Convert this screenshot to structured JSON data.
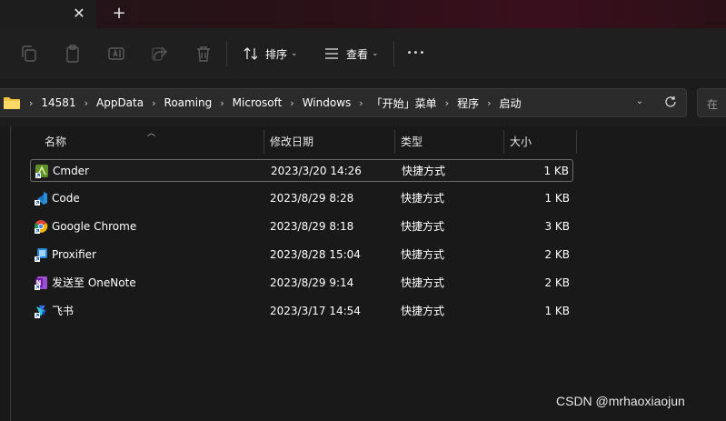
{
  "tabs": {
    "close_glyph": "✕",
    "new_glyph": "+"
  },
  "toolbar": {
    "sort_label": "排序",
    "view_label": "查看",
    "more_glyph": "•••",
    "chevron": "⌄"
  },
  "address": {
    "breadcrumbs": [
      "14581",
      "AppData",
      "Roaming",
      "Microsoft",
      "Windows",
      "「开始」菜单",
      "程序",
      "启动"
    ],
    "separator": "›",
    "search_placeholder": "在"
  },
  "columns": {
    "name": "名称",
    "modified": "修改日期",
    "type": "类型",
    "size": "大小"
  },
  "files": [
    {
      "name": "Cmder",
      "modified": "2023/3/20 14:26",
      "type": "快捷方式",
      "size": "1 KB",
      "icon": "cmder-icon"
    },
    {
      "name": "Code",
      "modified": "2023/8/29 8:28",
      "type": "快捷方式",
      "size": "1 KB",
      "icon": "vscode-icon"
    },
    {
      "name": "Google Chrome",
      "modified": "2023/8/29 8:18",
      "type": "快捷方式",
      "size": "3 KB",
      "icon": "chrome-icon"
    },
    {
      "name": "Proxifier",
      "modified": "2023/8/28 15:04",
      "type": "快捷方式",
      "size": "2 KB",
      "icon": "proxifier-icon"
    },
    {
      "name": "发送至 OneNote",
      "modified": "2023/8/29 9:14",
      "type": "快捷方式",
      "size": "2 KB",
      "icon": "onenote-icon"
    },
    {
      "name": "飞书",
      "modified": "2023/3/17 14:54",
      "type": "快捷方式",
      "size": "1 KB",
      "icon": "feishu-icon"
    }
  ],
  "watermark": "CSDN @mrhaoxiaojun",
  "colors": {
    "background": "#191919",
    "toolbar": "#1f1f1f",
    "folder": "#f4c542",
    "tab_gradient_end": "#3a0f1d"
  }
}
